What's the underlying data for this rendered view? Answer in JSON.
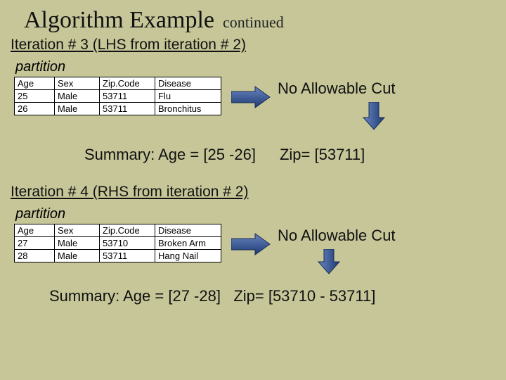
{
  "title": "Algorithm Example",
  "subtitle": "continued",
  "iter3": {
    "header": "Iteration # 3 (LHS from iteration # 2)",
    "partition_label": "partition",
    "table": {
      "headers": [
        "Age",
        "Sex",
        "Zip.Code",
        "Disease"
      ],
      "rows": [
        [
          "25",
          "Male",
          "53711",
          "Flu"
        ],
        [
          "26",
          "Male",
          "53711",
          "Bronchitus"
        ]
      ]
    },
    "no_cut": "No Allowable Cut",
    "summary": "Summary: Age = [25 -26]",
    "zip": "Zip= [53711]"
  },
  "iter4": {
    "header": "Iteration # 4 (RHS from iteration # 2)",
    "partition_label": "partition",
    "table": {
      "headers": [
        "Age",
        "Sex",
        "Zip.Code",
        "Disease"
      ],
      "rows": [
        [
          "27",
          "Male",
          "53710",
          "Broken Arm"
        ],
        [
          "28",
          "Male",
          "53711",
          "Hang Nail"
        ]
      ]
    },
    "no_cut": "No Allowable Cut",
    "summary": "Summary: Age = [27 -28]",
    "zip": "Zip= [53710 - 53711]"
  },
  "arrow_color": "#2a4c8a"
}
